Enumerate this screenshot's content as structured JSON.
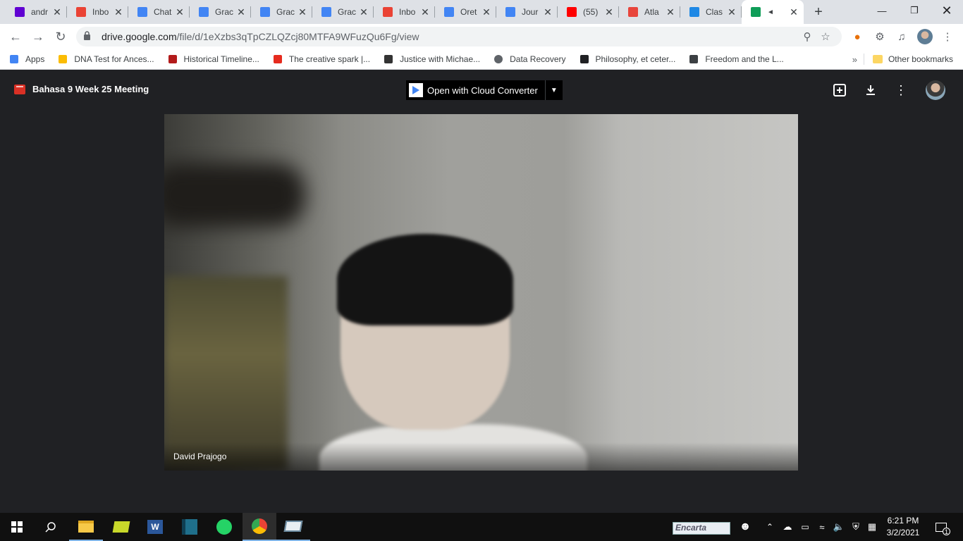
{
  "browser": {
    "tabs": [
      {
        "title": "andr",
        "icon": "mail-icon",
        "color": "#6001d2"
      },
      {
        "title": "Inbo",
        "icon": "gmail-icon",
        "color": "#ea4335"
      },
      {
        "title": "Chat",
        "icon": "docs-icon",
        "color": "#4285f4"
      },
      {
        "title": "Grac",
        "icon": "docs-icon",
        "color": "#4285f4"
      },
      {
        "title": "Grac",
        "icon": "docs-icon",
        "color": "#4285f4"
      },
      {
        "title": "Grac",
        "icon": "docs-icon",
        "color": "#4285f4"
      },
      {
        "title": "Inbo",
        "icon": "gmail-icon",
        "color": "#ea4335"
      },
      {
        "title": "Oret",
        "icon": "docs-icon",
        "color": "#4285f4"
      },
      {
        "title": "Jour",
        "icon": "docs-icon",
        "color": "#4285f4"
      },
      {
        "title": "(55)",
        "icon": "youtube-icon",
        "color": "#ff0000"
      },
      {
        "title": "Atla",
        "icon": "atlas-icon",
        "color": "#e8453c"
      },
      {
        "title": "Clas",
        "icon": "classroom-icon",
        "color": "#1e88e5"
      },
      {
        "title": "",
        "icon": "drive-icon",
        "color": "#0f9d58"
      }
    ],
    "active_tab_index": 12,
    "url_host": "drive.google.com",
    "url_path": "/file/d/1eXzbs3qTpCZLQZcj80MTFA9WFuzQu6Fg/view",
    "bookmarks": [
      {
        "label": "Apps",
        "icon": "apps-grid-icon"
      },
      {
        "label": "DNA Test for Ances...",
        "icon": "bookmark-yellow-icon"
      },
      {
        "label": "Historical Timeline...",
        "icon": "procon-icon"
      },
      {
        "label": "The creative spark |...",
        "icon": "ted-icon"
      },
      {
        "label": "Justice with Michae...",
        "icon": "justice-icon"
      },
      {
        "label": "Data Recovery",
        "icon": "globe-icon"
      },
      {
        "label": "Philosophy, et ceter...",
        "icon": "phi-icon"
      },
      {
        "label": "Freedom and the L...",
        "icon": "stripes-icon"
      }
    ],
    "other_bookmarks": "Other bookmarks"
  },
  "viewer": {
    "file_title": "Bahasa 9 Week 25 Meeting",
    "open_with_label": "Open with Cloud Converter",
    "participant_name": "David Prajogo"
  },
  "taskbar": {
    "encarta_label": "Encarta",
    "time": "6:21 PM",
    "date": "3/2/2021",
    "notification_count": "1"
  }
}
